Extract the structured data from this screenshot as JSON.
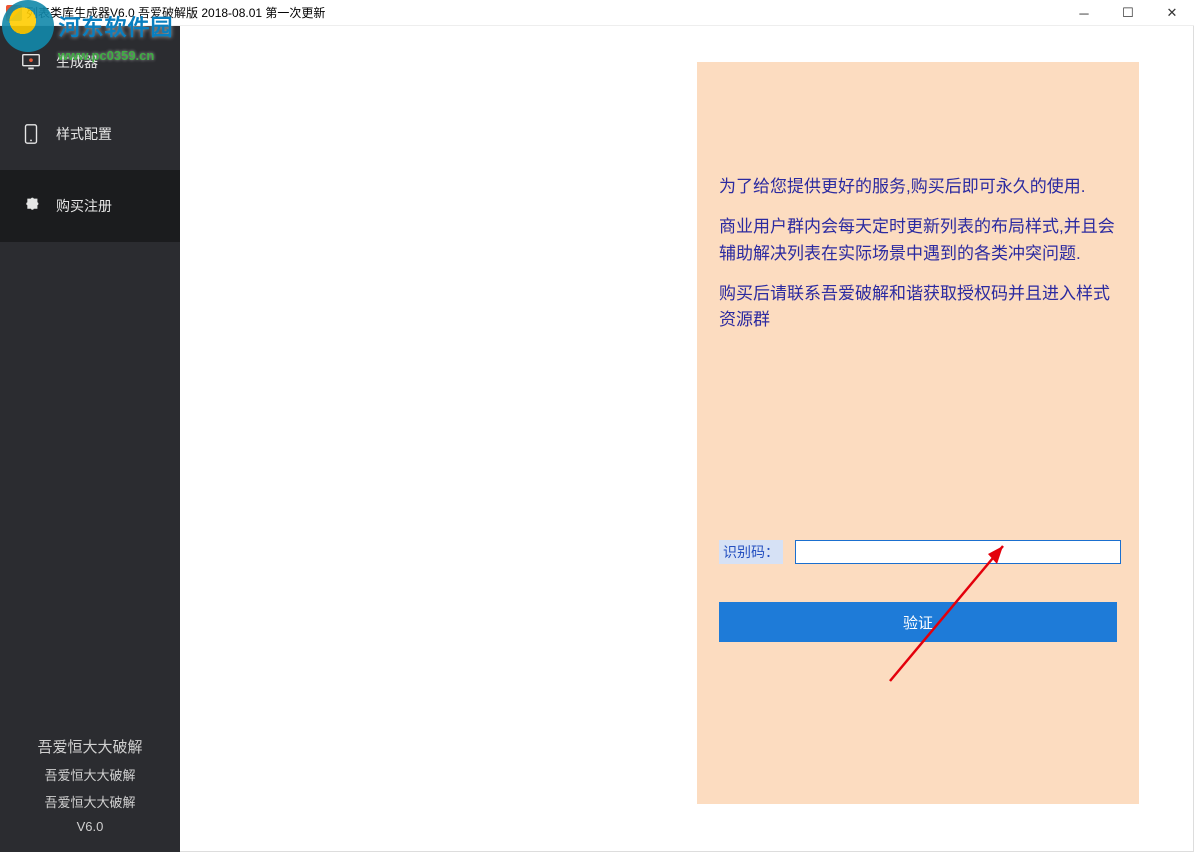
{
  "window": {
    "title": "列表类库生成器V6.0 吾爱破解版 2018-08.01 第一次更新"
  },
  "sidebar": {
    "items": [
      {
        "label": "生成器"
      },
      {
        "label": "样式配置"
      },
      {
        "label": "购买注册"
      }
    ],
    "footer": {
      "line1": "吾爱恒大大破解",
      "line2": "吾爱恒大大破解",
      "line3": "吾爱恒大大破解",
      "version": "V6.0"
    }
  },
  "panel": {
    "para1": "为了给您提供更好的服务,购买后即可永久的使用.",
    "para2": "商业用户群内会每天定时更新列表的布局样式,并且会辅助解决列表在实际场景中遇到的各类冲突问题.",
    "para3": "购买后请联系吾爱破解和谐获取授权码并且进入样式资源群",
    "id_label": "识别码：",
    "id_value": "",
    "verify_label": "验证"
  },
  "watermark": {
    "brand": "河东软件园",
    "url": "www.pc0359.cn"
  }
}
